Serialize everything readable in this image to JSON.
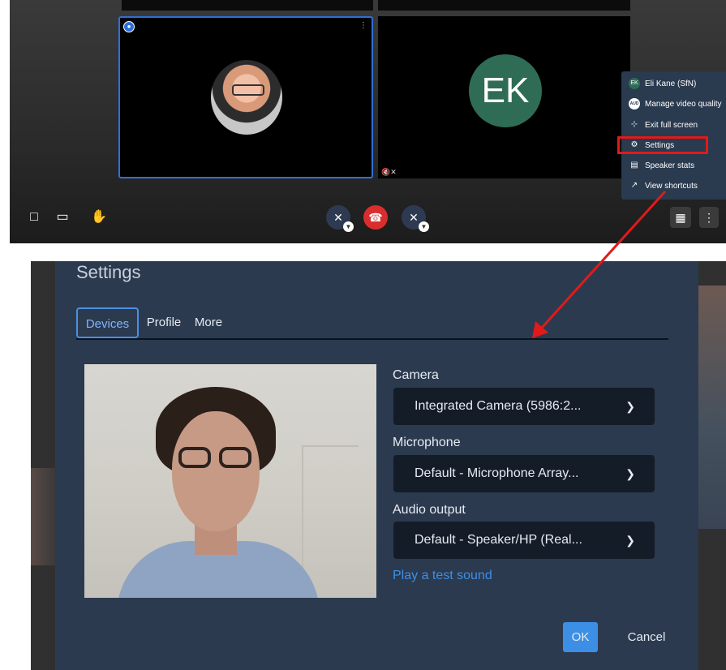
{
  "meeting": {
    "participants": [
      {
        "name": "speaker-with-photo",
        "initials": ""
      },
      {
        "name": "Eli Kane (SfN)",
        "initials": "EK"
      }
    ],
    "overflow_menu": {
      "items": [
        {
          "label": "Eli Kane (SfN)",
          "icon": "avatar-icon",
          "icon_text": "EK"
        },
        {
          "label": "Manage video quality",
          "icon": "video-quality-icon",
          "icon_text": "AUD"
        },
        {
          "label": "Exit full screen",
          "icon": "exit-fullscreen-icon"
        },
        {
          "label": "Settings",
          "icon": "gear-icon"
        },
        {
          "label": "Speaker stats",
          "icon": "bar-chart-icon"
        },
        {
          "label": "View shortcuts",
          "icon": "external-link-icon"
        }
      ]
    }
  },
  "settings": {
    "title": "Settings",
    "tabs": [
      {
        "label": "Devices",
        "selected": true
      },
      {
        "label": "Profile",
        "selected": false
      },
      {
        "label": "More",
        "selected": false
      }
    ],
    "camera": {
      "label": "Camera",
      "value": "Integrated Camera (5986:2..."
    },
    "microphone": {
      "label": "Microphone",
      "value": "Default - Microphone Array..."
    },
    "audio_output": {
      "label": "Audio output",
      "value": "Default - Speaker/HP (Real..."
    },
    "test_sound_link": "Play a test sound",
    "ok_label": "OK",
    "cancel_label": "Cancel"
  },
  "colors": {
    "dialog_bg": "#2b3a4f",
    "accent": "#3d8fe6",
    "highlight": "#e11a1a",
    "hangup": "#d92e2e"
  }
}
